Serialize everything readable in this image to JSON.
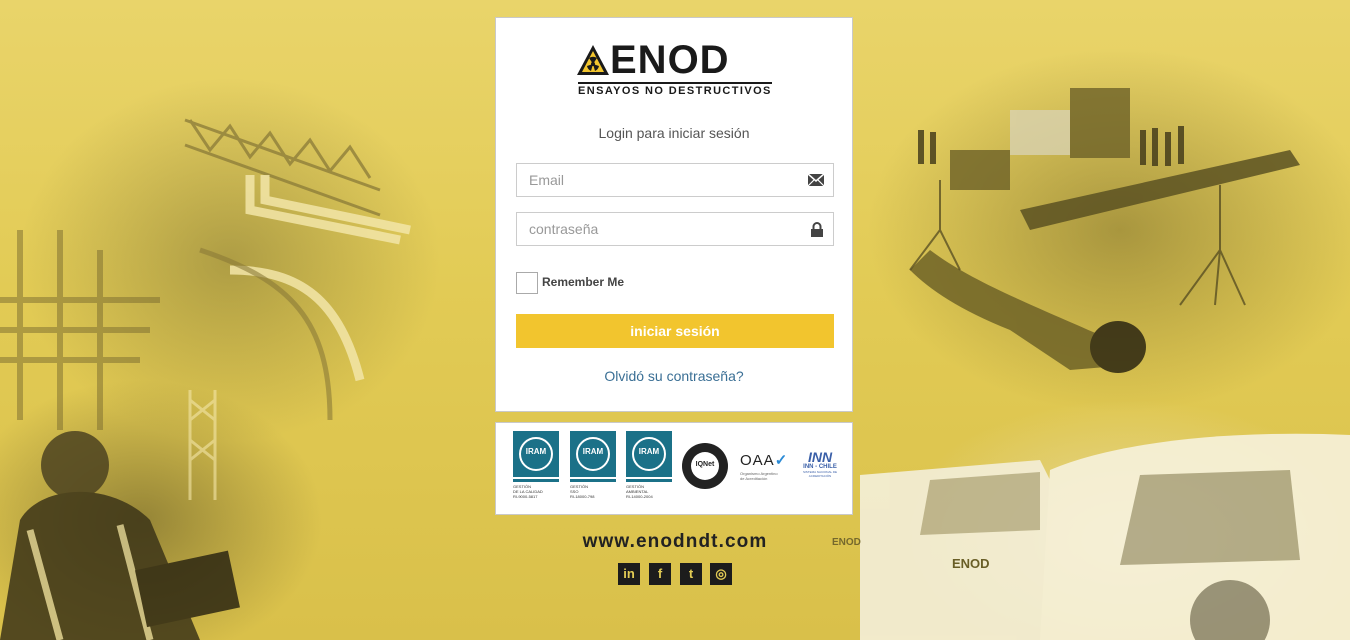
{
  "brand": {
    "name": "ENOD",
    "tagline": "ENSAYOS NO DESTRUCTIVOS"
  },
  "login": {
    "title": "Login para iniciar sesión",
    "email_placeholder": "Email",
    "password_placeholder": "contraseña",
    "remember_label": "Remember Me",
    "remember_checked": false,
    "submit_label": "iniciar sesión",
    "forgot_label": "Olvidó su contraseña?"
  },
  "certifications": {
    "iram": [
      {
        "logo": "IRAM",
        "line1": "GESTIÓN",
        "line2": "DE LA CALIDAD",
        "code": "RI-9000-5817"
      },
      {
        "logo": "IRAM",
        "line1": "GESTIÓN",
        "line2": "SSO",
        "code": "RI-18000-798"
      },
      {
        "logo": "IRAM",
        "line1": "GESTIÓN",
        "line2": "AMBIENTAL",
        "code": "RI-14000-2004"
      }
    ],
    "iqnet": "IQNet",
    "oaa": "OAA",
    "oaa_check": "✓",
    "oaa_sub": "Organismo Argentino de Acreditación",
    "inn_mark": "INN",
    "inn_name": "INN - CHILE",
    "inn_sub": "SISTEMA NACIONAL DE ACREDITACIÓN"
  },
  "footer": {
    "website": "www.enodndt.com",
    "social": [
      {
        "icon": "linkedin-icon",
        "glyph": "in"
      },
      {
        "icon": "facebook-icon",
        "glyph": "f"
      },
      {
        "icon": "twitter-icon",
        "glyph": "t"
      },
      {
        "icon": "instagram-icon",
        "glyph": "◎"
      }
    ]
  },
  "colors": {
    "background": "#e2cb55",
    "accent_button": "#f2c52e",
    "link": "#3a6f95",
    "iram_teal": "#1b7188"
  }
}
